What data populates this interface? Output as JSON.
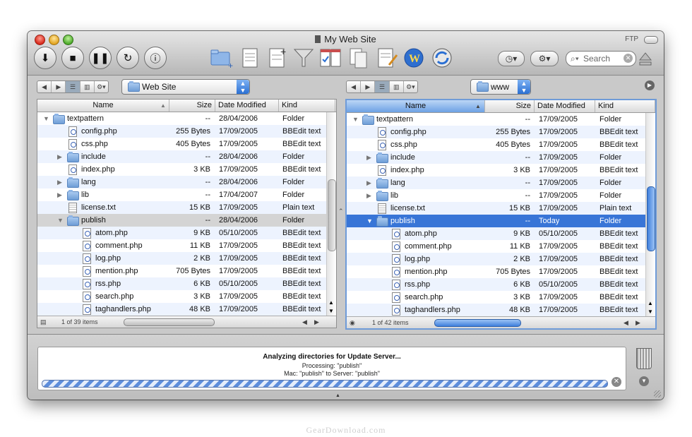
{
  "window": {
    "title": "My Web Site",
    "ftp_label": "FTP"
  },
  "toolbar": {
    "search_placeholder": "Search"
  },
  "left": {
    "location": "Web Site",
    "columns": [
      "Name",
      "Size",
      "Date Modified",
      "Kind"
    ],
    "items_count": "1 of 39 items",
    "rows": [
      {
        "name": "textpattern",
        "size": "--",
        "date": "28/04/2006",
        "kind": "Folder",
        "type": "folder",
        "indent": 0,
        "disclosure": "open"
      },
      {
        "name": "config.php",
        "size": "255 Bytes",
        "date": "17/09/2005",
        "kind": "BBEdit text",
        "type": "php",
        "indent": 1
      },
      {
        "name": "css.php",
        "size": "405 Bytes",
        "date": "17/09/2005",
        "kind": "BBEdit text",
        "type": "php",
        "indent": 1
      },
      {
        "name": "include",
        "size": "--",
        "date": "28/04/2006",
        "kind": "Folder",
        "type": "folder",
        "indent": 1,
        "disclosure": "closed"
      },
      {
        "name": "index.php",
        "size": "3 KB",
        "date": "17/09/2005",
        "kind": "BBEdit text",
        "type": "php",
        "indent": 1
      },
      {
        "name": "lang",
        "size": "--",
        "date": "28/04/2006",
        "kind": "Folder",
        "type": "folder",
        "indent": 1,
        "disclosure": "closed"
      },
      {
        "name": "lib",
        "size": "--",
        "date": "17/04/2007",
        "kind": "Folder",
        "type": "folder",
        "indent": 1,
        "disclosure": "closed"
      },
      {
        "name": "license.txt",
        "size": "15 KB",
        "date": "17/09/2005",
        "kind": "Plain text",
        "type": "txt",
        "indent": 1
      },
      {
        "name": "publish",
        "size": "--",
        "date": "28/04/2006",
        "kind": "Folder",
        "type": "folder",
        "indent": 1,
        "disclosure": "open",
        "highlight": "gray"
      },
      {
        "name": "atom.php",
        "size": "9 KB",
        "date": "05/10/2005",
        "kind": "BBEdit text",
        "type": "php",
        "indent": 2
      },
      {
        "name": "comment.php",
        "size": "11 KB",
        "date": "17/09/2005",
        "kind": "BBEdit text",
        "type": "php",
        "indent": 2
      },
      {
        "name": "log.php",
        "size": "2 KB",
        "date": "17/09/2005",
        "kind": "BBEdit text",
        "type": "php",
        "indent": 2
      },
      {
        "name": "mention.php",
        "size": "705 Bytes",
        "date": "17/09/2005",
        "kind": "BBEdit text",
        "type": "php",
        "indent": 2
      },
      {
        "name": "rss.php",
        "size": "6 KB",
        "date": "05/10/2005",
        "kind": "BBEdit text",
        "type": "php",
        "indent": 2
      },
      {
        "name": "search.php",
        "size": "3 KB",
        "date": "17/09/2005",
        "kind": "BBEdit text",
        "type": "php",
        "indent": 2
      },
      {
        "name": "taghandlers.php",
        "size": "48 KB",
        "date": "17/09/2005",
        "kind": "BBEdit text",
        "type": "php",
        "indent": 2
      }
    ]
  },
  "right": {
    "location": "www",
    "columns": [
      "Name",
      "Size",
      "Date Modified",
      "Kind"
    ],
    "items_count": "1 of 42 items",
    "rows": [
      {
        "name": "textpattern",
        "size": "--",
        "date": "17/09/2005",
        "kind": "Folder",
        "type": "folder",
        "indent": 0,
        "disclosure": "open"
      },
      {
        "name": "config.php",
        "size": "255 Bytes",
        "date": "17/09/2005",
        "kind": "BBEdit text",
        "type": "php",
        "indent": 1
      },
      {
        "name": "css.php",
        "size": "405 Bytes",
        "date": "17/09/2005",
        "kind": "BBEdit text",
        "type": "php",
        "indent": 1
      },
      {
        "name": "include",
        "size": "--",
        "date": "17/09/2005",
        "kind": "Folder",
        "type": "folder",
        "indent": 1,
        "disclosure": "closed"
      },
      {
        "name": "index.php",
        "size": "3 KB",
        "date": "17/09/2005",
        "kind": "BBEdit text",
        "type": "php",
        "indent": 1
      },
      {
        "name": "lang",
        "size": "--",
        "date": "17/09/2005",
        "kind": "Folder",
        "type": "folder",
        "indent": 1,
        "disclosure": "closed"
      },
      {
        "name": "lib",
        "size": "--",
        "date": "17/09/2005",
        "kind": "Folder",
        "type": "folder",
        "indent": 1,
        "disclosure": "closed"
      },
      {
        "name": "license.txt",
        "size": "15 KB",
        "date": "17/09/2005",
        "kind": "Plain text",
        "type": "txt",
        "indent": 1
      },
      {
        "name": "publish",
        "size": "--",
        "date": "Today",
        "kind": "Folder",
        "type": "folder",
        "indent": 1,
        "disclosure": "open",
        "highlight": "blue"
      },
      {
        "name": "atom.php",
        "size": "9 KB",
        "date": "05/10/2005",
        "kind": "BBEdit text",
        "type": "php",
        "indent": 2
      },
      {
        "name": "comment.php",
        "size": "11 KB",
        "date": "17/09/2005",
        "kind": "BBEdit text",
        "type": "php",
        "indent": 2
      },
      {
        "name": "log.php",
        "size": "2 KB",
        "date": "17/09/2005",
        "kind": "BBEdit text",
        "type": "php",
        "indent": 2
      },
      {
        "name": "mention.php",
        "size": "705 Bytes",
        "date": "17/09/2005",
        "kind": "BBEdit text",
        "type": "php",
        "indent": 2
      },
      {
        "name": "rss.php",
        "size": "6 KB",
        "date": "05/10/2005",
        "kind": "BBEdit text",
        "type": "php",
        "indent": 2
      },
      {
        "name": "search.php",
        "size": "3 KB",
        "date": "17/09/2005",
        "kind": "BBEdit text",
        "type": "php",
        "indent": 2
      },
      {
        "name": "taghandlers.php",
        "size": "48 KB",
        "date": "17/09/2005",
        "kind": "BBEdit text",
        "type": "php",
        "indent": 2
      }
    ]
  },
  "status": {
    "title": "Analyzing directories for Update Server...",
    "processing": "Processing: \"publish\"",
    "mapping": "Mac: \"publish\" to Server: \"publish\""
  },
  "watermark": "GearDownload.com",
  "colors": {
    "selection": "#3875d7",
    "alt_row": "#edf3fe",
    "accent": "#2a6fd3"
  }
}
